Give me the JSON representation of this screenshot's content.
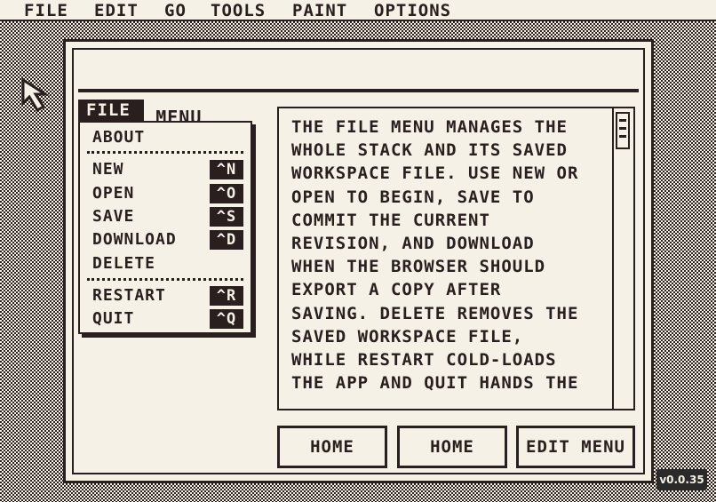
{
  "menubar": {
    "items": [
      "FILE",
      "EDIT",
      "GO",
      "TOOLS",
      "PAINT",
      "OPTIONS"
    ]
  },
  "card": {
    "title": "FILE MENU"
  },
  "file_menu": {
    "tab_label": "FILE",
    "items": [
      {
        "label": "ABOUT",
        "shortcut": ""
      },
      {
        "label": "NEW",
        "shortcut": "^N"
      },
      {
        "label": "OPEN",
        "shortcut": "^O"
      },
      {
        "label": "SAVE",
        "shortcut": "^S"
      },
      {
        "label": "DOWNLOAD",
        "shortcut": "^D"
      },
      {
        "label": "DELETE",
        "shortcut": ""
      },
      {
        "label": "RESTART",
        "shortcut": "^R"
      },
      {
        "label": "QUIT",
        "shortcut": "^Q"
      }
    ]
  },
  "text_field": {
    "content": "THE FILE MENU MANAGES THE\nWHOLE STACK AND ITS SAVED\nWORKSPACE FILE. USE NEW OR\nOPEN TO BEGIN, SAVE TO\nCOMMIT THE CURRENT\nREVISION, AND DOWNLOAD\nWHEN THE BROWSER SHOULD\nEXPORT A COPY AFTER\nSAVING. DELETE REMOVES THE\nSAVED WORKSPACE FILE,\nWHILE RESTART COLD-LOADS\nTHE APP AND QUIT HANDS THE"
  },
  "buttons": {
    "home_1": "HOME",
    "home_2": "HOME",
    "edit_menu": "EDIT MENU"
  },
  "version": "v0.0.35",
  "icons": {
    "cursor": "arrow-pointer-icon",
    "scroll": "scroll-thumb-icon"
  },
  "colors": {
    "ink": "#2a1f1f",
    "paper": "#f5f1e6",
    "badge": "#2a2a2a"
  }
}
